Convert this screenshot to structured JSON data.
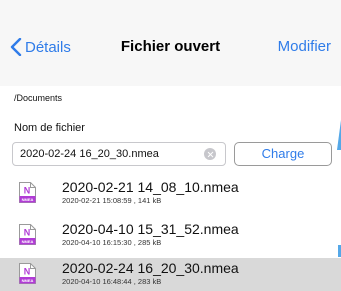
{
  "navbar": {
    "back_label": "Détails",
    "title": "Fichier ouvert",
    "edit_label": "Modifier"
  },
  "path": "/Documents",
  "filename_label": "Nom de fichier",
  "filename_input": {
    "value": "2020-02-24 16_20_30.nmea",
    "placeholder": ""
  },
  "load_button_label": "Charge",
  "file_icon": {
    "letter": "N",
    "badge": "NMEA",
    "accent": "#b13bd6"
  },
  "files": [
    {
      "name": "2020-02-21 14_08_10.nmea",
      "meta": "2020-02-21 15:08:59 , 141 kB",
      "selected": false
    },
    {
      "name": "2020-04-10 15_31_52.nmea",
      "meta": "2020-04-10 16:15:30 , 285 kB",
      "selected": false
    },
    {
      "name": "2020-02-24 16_20_30.nmea",
      "meta": "2020-04-10 16:48:44 , 283 kB",
      "selected": true
    }
  ],
  "colors": {
    "accent": "#2f7ce9",
    "selected_row": "#d9d9d9",
    "nav_background": "#f7f7f7"
  }
}
